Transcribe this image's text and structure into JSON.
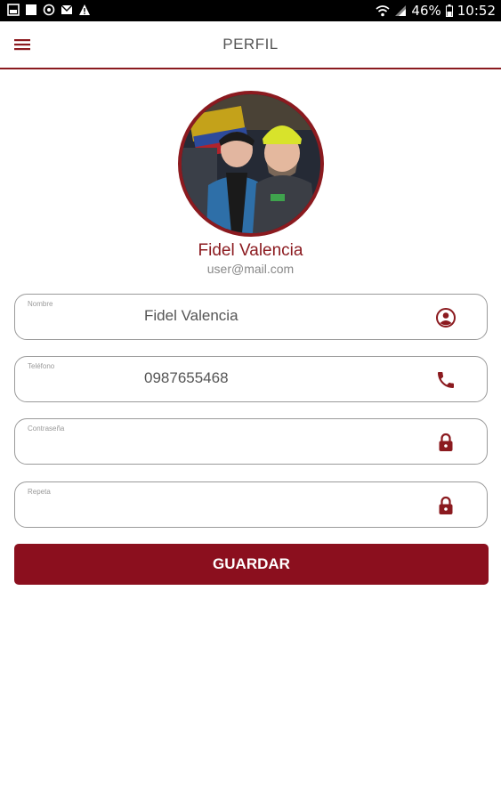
{
  "status_bar": {
    "battery": "46%",
    "time": "10:52"
  },
  "header": {
    "title": "PERFIL"
  },
  "profile": {
    "name": "Fidel Valencia",
    "email": "user@mail.com"
  },
  "form": {
    "name_label": "Nombre",
    "name_value": "Fidel Valencia",
    "phone_label": "Teléfono",
    "phone_value": "0987655468",
    "password_label": "Contraseña",
    "password_value": "",
    "repeat_label": "Repeta",
    "repeat_value": ""
  },
  "actions": {
    "save_label": "GUARDAR"
  },
  "colors": {
    "accent": "#8b1a1f",
    "button": "#8b0f1e"
  }
}
